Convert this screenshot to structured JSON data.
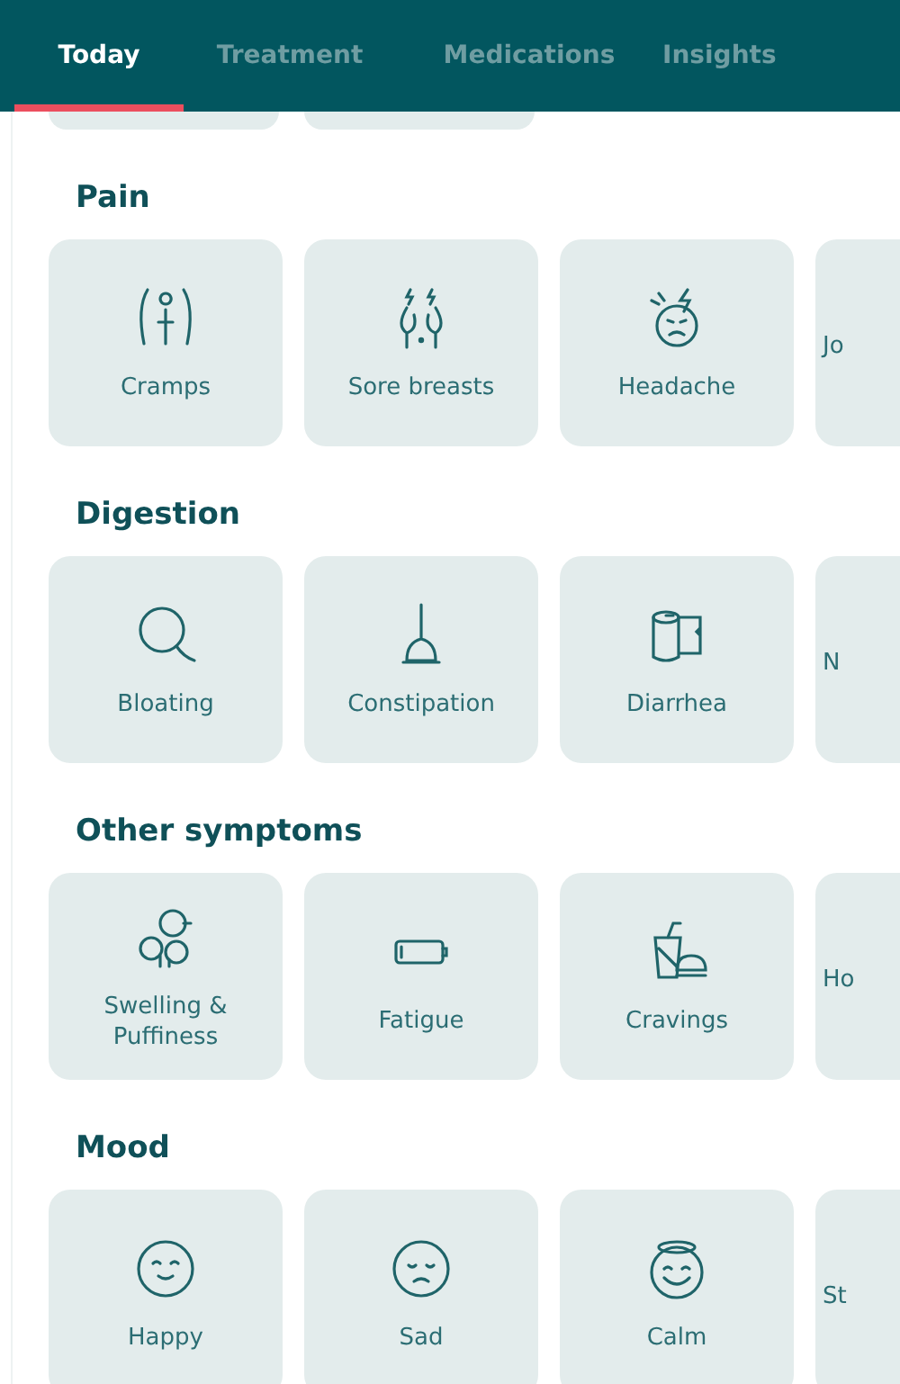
{
  "tabs": [
    {
      "label": "Today",
      "selected": true
    },
    {
      "label": "Treatment",
      "selected": false
    },
    {
      "label": "Medications",
      "selected": false
    },
    {
      "label": "Insights",
      "selected": false
    }
  ],
  "sections": [
    {
      "title": "Pain",
      "items": [
        "Cramps",
        "Sore breasts",
        "Headache"
      ],
      "cut_item": "Jo"
    },
    {
      "title": "Digestion",
      "items": [
        "Bloating",
        "Constipation",
        "Diarrhea"
      ],
      "cut_item": "N"
    },
    {
      "title": "Other symptoms",
      "items": [
        "Swelling & Puffiness",
        "Fatigue",
        "Cravings"
      ],
      "cut_item": "Ho"
    },
    {
      "title": "Mood",
      "items": [
        "Happy",
        "Sad",
        "Calm"
      ],
      "cut_item": "St"
    }
  ]
}
